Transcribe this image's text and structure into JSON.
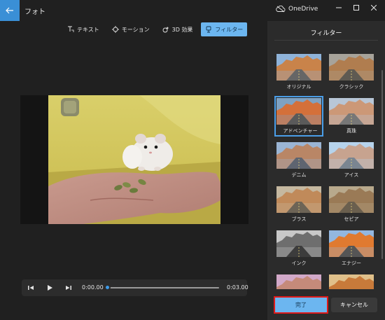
{
  "window": {
    "title": "フォト",
    "onedrive": "OneDrive"
  },
  "toolbar": {
    "items": [
      {
        "label": "テキスト",
        "icon": "text-icon"
      },
      {
        "label": "モーション",
        "icon": "motion-icon"
      },
      {
        "label": "3D 効果",
        "icon": "3d-effects-icon"
      },
      {
        "label": "フィルター",
        "icon": "filter-icon",
        "active": true
      }
    ]
  },
  "player": {
    "current_time": "0:00.00",
    "end_time": "0:03.00",
    "progress": 0
  },
  "panel": {
    "title": "フィルター",
    "filters": [
      {
        "label": "オリジナル",
        "selected": false
      },
      {
        "label": "クラシック",
        "selected": false
      },
      {
        "label": "アドベンチャー",
        "selected": true
      },
      {
        "label": "真珠",
        "selected": false
      },
      {
        "label": "デニム",
        "selected": false
      },
      {
        "label": "アイス",
        "selected": false
      },
      {
        "label": "ブラス",
        "selected": false
      },
      {
        "label": "セピア",
        "selected": false
      },
      {
        "label": "インク",
        "selected": false
      },
      {
        "label": "エナジー",
        "selected": false
      },
      {
        "label": "",
        "selected": false
      },
      {
        "label": "",
        "selected": false
      }
    ],
    "done_label": "完了",
    "cancel_label": "キャンセル"
  },
  "colors": {
    "accent": "#6cb6f0",
    "highlight_border": "#e01a1a",
    "background": "#202020",
    "panel": "#2b2b2b"
  }
}
